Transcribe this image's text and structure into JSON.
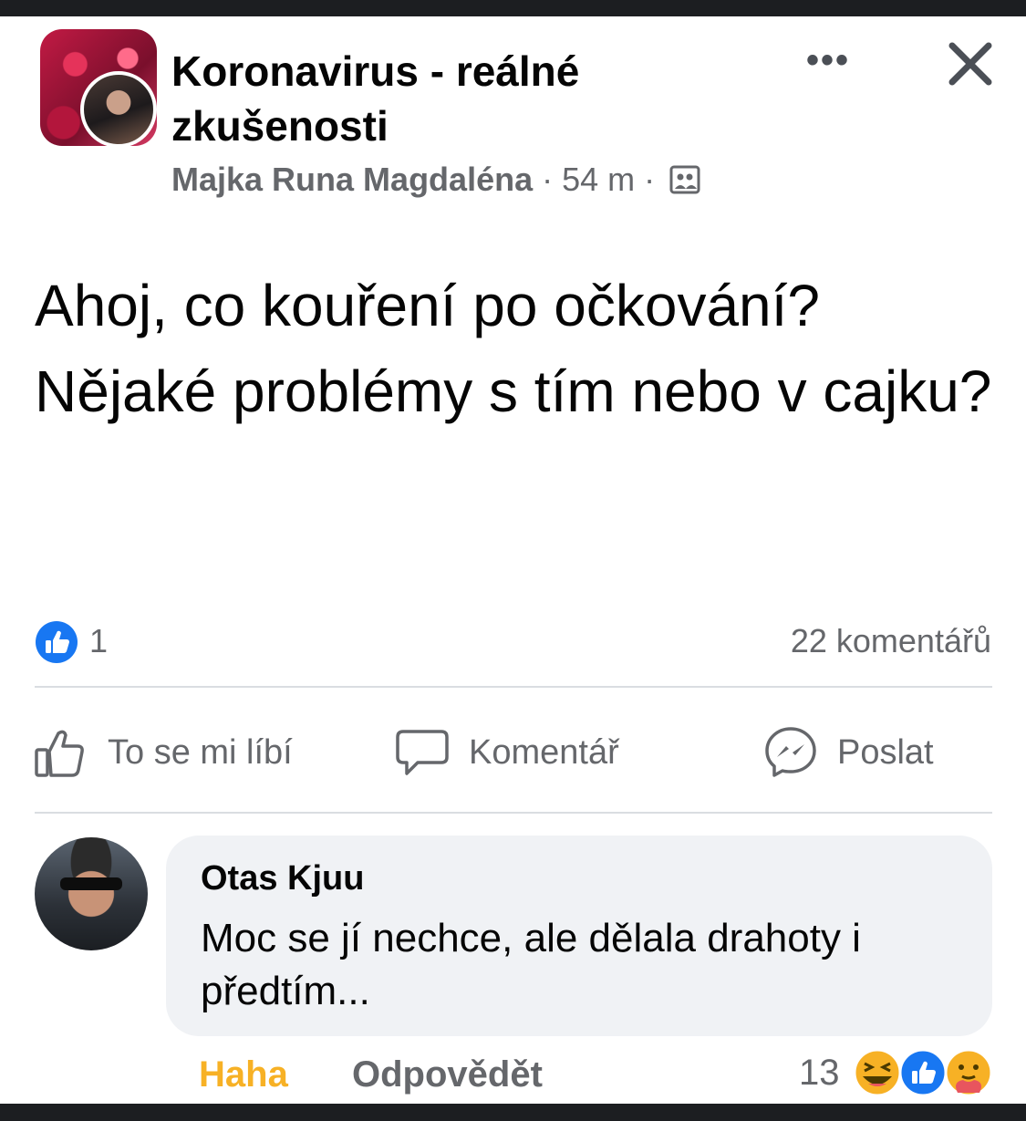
{
  "post": {
    "group_name": "Koronavirus - reálné zkušenosti",
    "author": "Majka Runa Magdaléna",
    "separator": "·",
    "time": "54 m",
    "body": "Ahoj, co kouření po očkování? Nějaké problémy s tím nebo v cajku?",
    "like_count": "1",
    "comment_count": "22 komentářů"
  },
  "actions": {
    "like_label": "To se mi líbí",
    "comment_label": "Komentář",
    "send_label": "Poslat"
  },
  "comment": {
    "author": "Otas Kjuu",
    "text": "Moc se jí nechce, ale dělala drahoty i předtím...",
    "haha_label": "Haha",
    "reply_label": "Odpovědět",
    "reaction_count": "13",
    "reactions": [
      "haha-icon",
      "like-icon",
      "care-icon"
    ]
  },
  "icons": {
    "more": "more-options-icon",
    "close": "close-icon",
    "privacy": "group-privacy-icon"
  },
  "colors": {
    "like_blue": "#1877f2",
    "haha_yellow": "#f7b125",
    "secondary_text": "#65676b"
  }
}
